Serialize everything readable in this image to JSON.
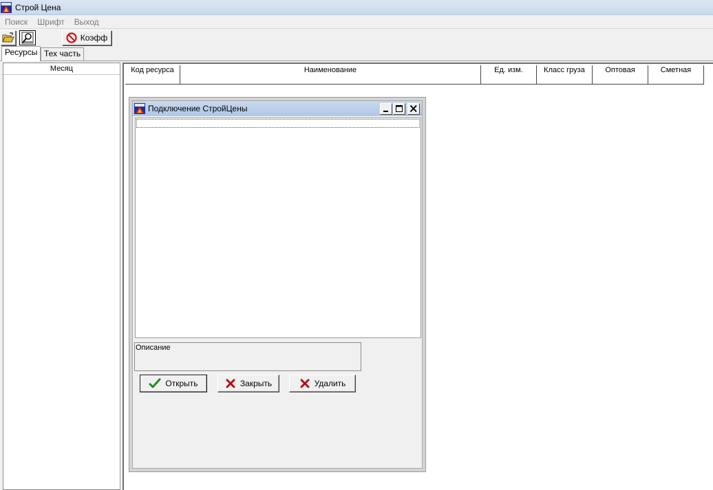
{
  "window": {
    "title": "Строй Цена"
  },
  "menu": {
    "items": [
      "Поиск",
      "Шрифт",
      "Выход"
    ]
  },
  "toolbar": {
    "open_icon": "folder-open-icon",
    "search_icon": "magnifier-icon",
    "koef_label": "Коэфф",
    "koef_icon": "no-entry-icon"
  },
  "tabs": [
    {
      "label": "Ресурсы",
      "active": true
    },
    {
      "label": "Тех часть",
      "active": false
    }
  ],
  "left_panel": {
    "header": "Месяц"
  },
  "grid": {
    "columns": [
      "Код ресурса",
      "Наименование",
      "Ед. изм.",
      "Класс груза",
      "Оптовая",
      "Сметная"
    ]
  },
  "dialog": {
    "title": "Подключение СтройЦены",
    "description_label": "Описание",
    "buttons": {
      "open": "Открыть",
      "close": "Закрыть",
      "delete": "Удалить"
    }
  },
  "colors": {
    "check_green": "#1f8a1f",
    "cross_red": "#b01010",
    "no_entry_red": "#d01010"
  }
}
